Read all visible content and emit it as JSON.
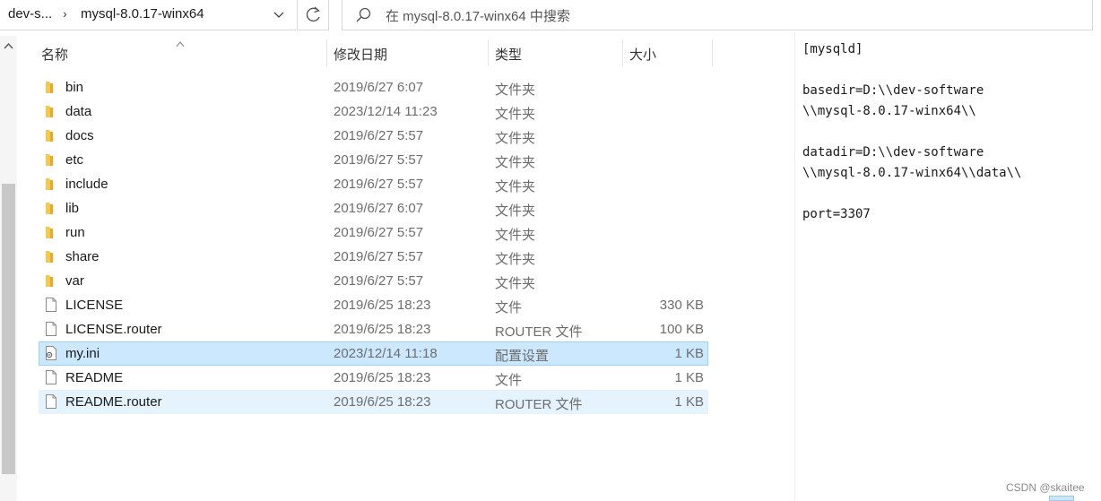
{
  "address": {
    "crumbs": [
      "dev-s...",
      "mysql-8.0.17-winx64"
    ],
    "separator": "›"
  },
  "search": {
    "placeholder": "在 mysql-8.0.17-winx64 中搜索"
  },
  "columns": {
    "name": "名称",
    "date": "修改日期",
    "type": "类型",
    "size": "大小"
  },
  "files": [
    {
      "name": "bin",
      "date": "2019/6/27 6:07",
      "type": "文件夹",
      "size": "",
      "icon": "folder-icon"
    },
    {
      "name": "data",
      "date": "2023/12/14 11:23",
      "type": "文件夹",
      "size": "",
      "icon": "folder-icon"
    },
    {
      "name": "docs",
      "date": "2019/6/27 5:57",
      "type": "文件夹",
      "size": "",
      "icon": "folder-icon"
    },
    {
      "name": "etc",
      "date": "2019/6/27 5:57",
      "type": "文件夹",
      "size": "",
      "icon": "folder-icon"
    },
    {
      "name": "include",
      "date": "2019/6/27 5:57",
      "type": "文件夹",
      "size": "",
      "icon": "folder-icon"
    },
    {
      "name": "lib",
      "date": "2019/6/27 6:07",
      "type": "文件夹",
      "size": "",
      "icon": "folder-icon"
    },
    {
      "name": "run",
      "date": "2019/6/27 5:57",
      "type": "文件夹",
      "size": "",
      "icon": "folder-icon"
    },
    {
      "name": "share",
      "date": "2019/6/27 5:57",
      "type": "文件夹",
      "size": "",
      "icon": "folder-icon"
    },
    {
      "name": "var",
      "date": "2019/6/27 5:57",
      "type": "文件夹",
      "size": "",
      "icon": "folder-icon"
    },
    {
      "name": "LICENSE",
      "date": "2019/6/25 18:23",
      "type": "文件",
      "size": "330 KB",
      "icon": "file-icon"
    },
    {
      "name": "LICENSE.router",
      "date": "2019/6/25 18:23",
      "type": "ROUTER 文件",
      "size": "100 KB",
      "icon": "file-icon"
    },
    {
      "name": "my.ini",
      "date": "2023/12/14 11:18",
      "type": "配置设置",
      "size": "1 KB",
      "icon": "settings-file-icon",
      "state": "selected"
    },
    {
      "name": "README",
      "date": "2019/6/25 18:23",
      "type": "文件",
      "size": "1 KB",
      "icon": "file-icon"
    },
    {
      "name": "README.router",
      "date": "2019/6/25 18:23",
      "type": "ROUTER 文件",
      "size": "1 KB",
      "icon": "file-icon",
      "state": "hover"
    }
  ],
  "preview": {
    "lines": [
      "[mysqld]",
      "",
      "basedir=D:\\\\dev-software",
      "\\\\mysql-8.0.17-winx64\\\\",
      "",
      "datadir=D:\\\\dev-software",
      "\\\\mysql-8.0.17-winx64\\\\data\\\\",
      "",
      "port=3307"
    ]
  },
  "watermark": "CSDN @skaitee",
  "colors": {
    "selected_bg": "#cce8ff",
    "hover_bg": "#e5f3ff",
    "folder": "#f8c84a"
  }
}
